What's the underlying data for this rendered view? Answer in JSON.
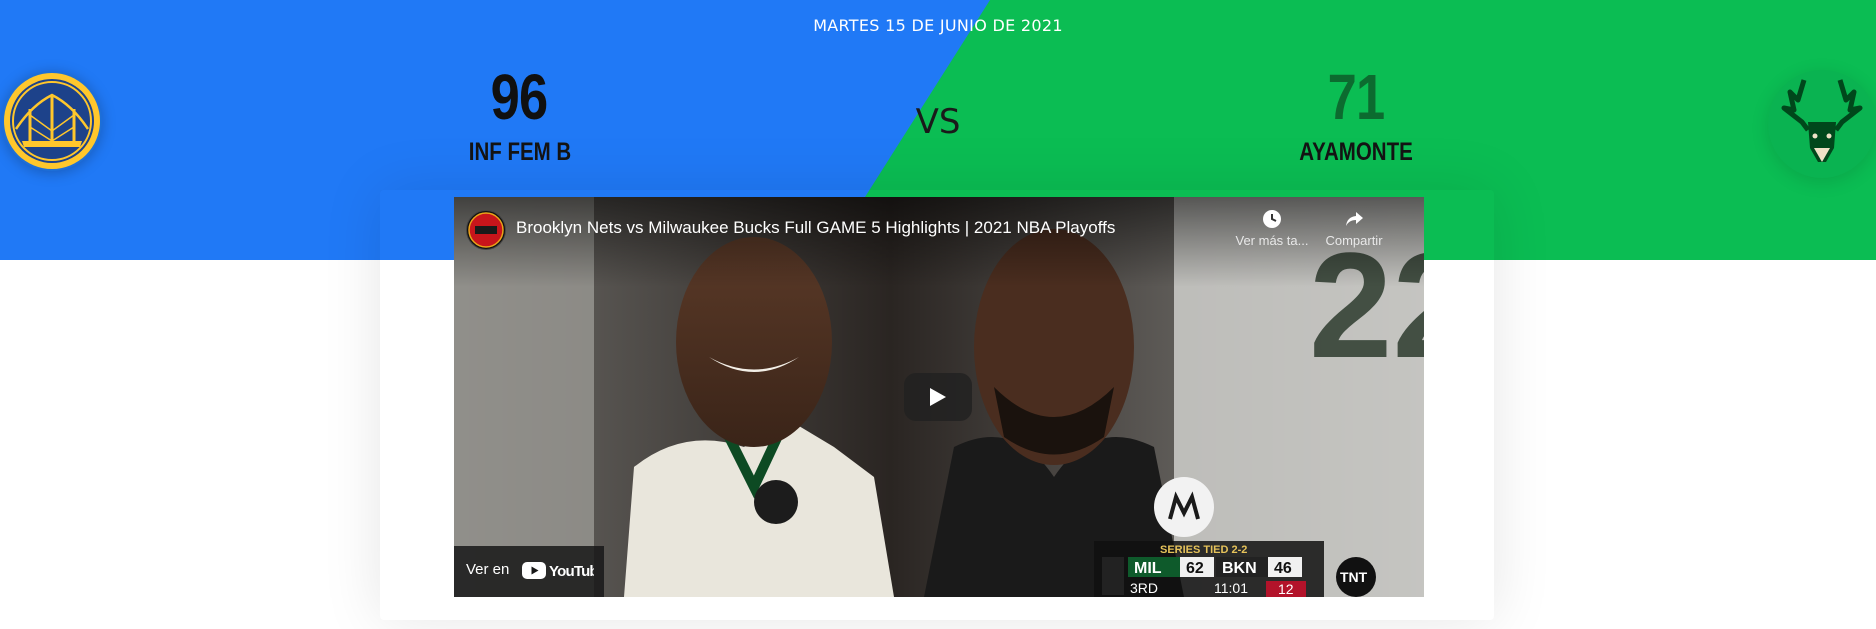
{
  "header": {
    "date": "MARTES 15 DE JUNIO DE 2021",
    "vs_label": "VS"
  },
  "home": {
    "score": "96",
    "name": "INF FEM B",
    "color": "#2079f6"
  },
  "away": {
    "score": "71",
    "name": "AYAMONTE",
    "color": "#0bbd53"
  },
  "video": {
    "title": "Brooklyn Nets vs Milwaukee Bucks Full GAME 5 Highlights | 2021 NBA Playoffs",
    "watch_later_label": "Ver más ta...",
    "share_label": "Compartir",
    "watch_on_label": "Ver en",
    "youtube_label": "YouTube",
    "scorebug": {
      "series": "SERIES TIED 2-2",
      "team1": "MIL",
      "score1": "62",
      "team2": "BKN",
      "score2": "46",
      "period": "3RD",
      "clock": "11:01",
      "shot_clock": "12",
      "network": "TNT"
    }
  },
  "icons": {
    "home_logo": "warriors-logo-icon",
    "away_logo": "bucks-logo-icon",
    "watch_later": "clock-icon",
    "share": "share-icon",
    "play": "play-icon",
    "youtube": "youtube-logo-icon"
  }
}
